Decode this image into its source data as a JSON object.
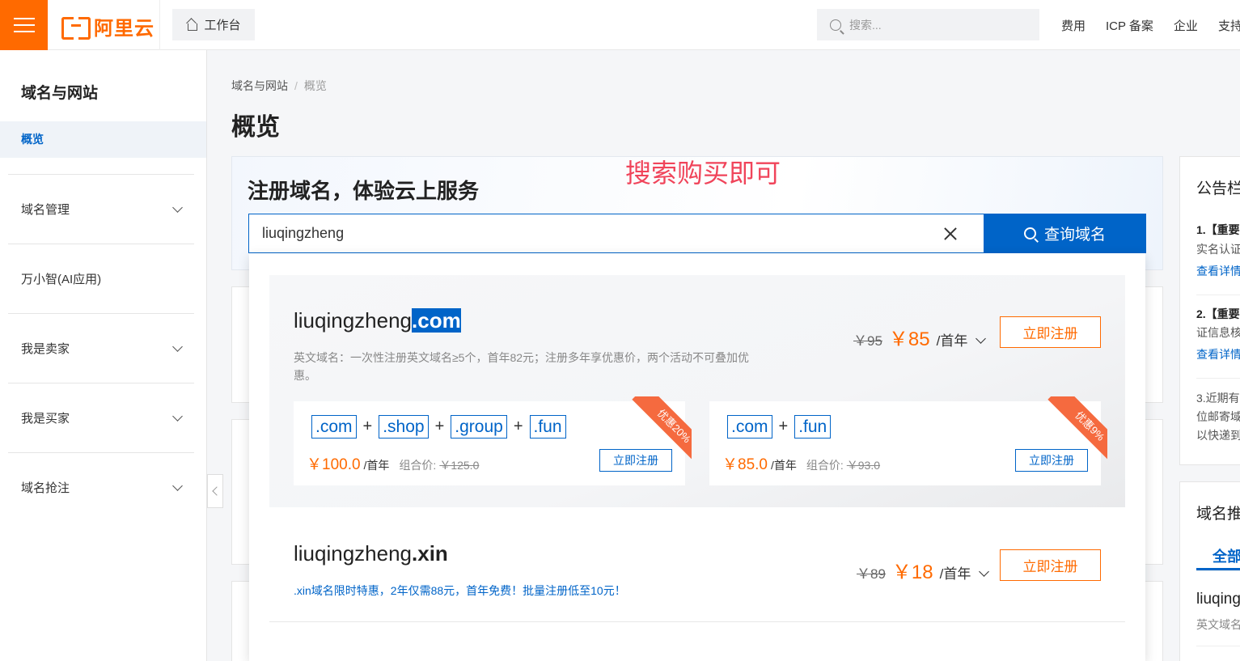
{
  "topbar": {
    "logo_text": "阿里云",
    "workbench_label": "工作台",
    "search_placeholder": "搜索...",
    "nav": [
      "费用",
      "ICP 备案",
      "企业",
      "支持"
    ]
  },
  "sidebar": {
    "title": "域名与网站",
    "active_item": "概览",
    "items": [
      "域名管理",
      "万小智(AI应用)",
      "我是卖家",
      "我是买家",
      "域名抢注"
    ]
  },
  "breadcrumb": {
    "root": "域名与网站",
    "separator": "/",
    "current": "概览"
  },
  "page_title": "概览",
  "register": {
    "title": "注册域名，体验云上服务",
    "annotation": "搜索购买即可",
    "query_value": "liuqingzheng",
    "query_button": "查询域名"
  },
  "results": [
    {
      "name": "liuqingzheng",
      "tld": ".com",
      "desc": "英文域名：一次性注册英文域名≥5个，首年82元；注册多年享优惠价，两个活动不可叠加优惠。",
      "old_price": "￥95",
      "price": "￥85",
      "unit": "/首年",
      "button": "立即注册",
      "combos": [
        {
          "tags": [
            ".com",
            ".shop",
            ".group",
            ".fun"
          ],
          "price": "￥100.0",
          "unit": "/首年",
          "combo_label": "组合价:",
          "combo_old": "￥125.0",
          "button": "立即注册",
          "ribbon": "优惠20%"
        },
        {
          "tags": [
            ".com",
            ".fun"
          ],
          "price": "￥85.0",
          "unit": "/首年",
          "combo_label": "组合价:",
          "combo_old": "￥93.0",
          "button": "立即注册",
          "ribbon": "优惠9%"
        }
      ]
    },
    {
      "name": "liuqingzheng",
      "tld": ".xin",
      "desc": ".xin域名限时特惠，2年仅需88元，首年免费！批量注册低至10元！",
      "old_price": "￥89",
      "price": "￥18",
      "unit": "/首年",
      "button": "立即注册"
    }
  ],
  "notice": {
    "title": "公告栏",
    "item1": "1.【重要",
    "item1_text": "实名认证",
    "item1_link": "查看详情",
    "item2": "2.【重要",
    "item2_text": "证信息核",
    "item2_link": "查看详情",
    "item3_lines": [
      "3.近期有",
      "位邮寄域",
      "以快递到"
    ]
  },
  "domain_reco": {
    "title": "域名推荐",
    "tab": "全部",
    "item_name": "liuqing",
    "item_desc": "英文域名"
  },
  "colors": {
    "brand": "#ff6a00",
    "primary": "#0064c8",
    "annotation": "#f0445a"
  }
}
